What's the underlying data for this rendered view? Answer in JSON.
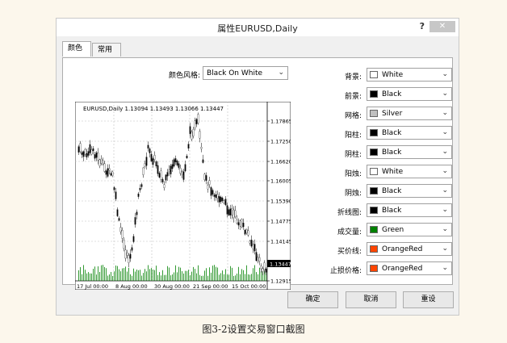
{
  "window": {
    "title": "属性EURUSD,Daily",
    "help": "?",
    "close": "✕"
  },
  "tabs": [
    {
      "label": "颜色"
    },
    {
      "label": "常用"
    }
  ],
  "color_style": {
    "label": "颜色风格:",
    "value": "Black On White"
  },
  "chart": {
    "info": "EURUSD,Daily  1.13094 1.13493 1.13066 1.13447",
    "price_ticks": [
      "1.17865",
      "1.17250",
      "1.16620",
      "1.16005",
      "1.15390",
      "1.14775",
      "1.14145",
      "1.13447",
      "1.12915"
    ],
    "current_price": "1.13447",
    "date_ticks": [
      "17 Jul 00:00",
      "8 Aug 00:00",
      "30 Aug 00:00",
      "21 Sep 00:00",
      "15 Oct 00:00"
    ]
  },
  "colors": [
    {
      "label": "背景:",
      "value": "White",
      "hex": "#ffffff"
    },
    {
      "label": "前景:",
      "value": "Black",
      "hex": "#000000"
    },
    {
      "label": "网格:",
      "value": "Silver",
      "hex": "#c0c0c0"
    },
    {
      "label": "阳柱:",
      "value": "Black",
      "hex": "#000000"
    },
    {
      "label": "阴柱:",
      "value": "Black",
      "hex": "#000000"
    },
    {
      "label": "阳烛:",
      "value": "White",
      "hex": "#ffffff"
    },
    {
      "label": "阴烛:",
      "value": "Black",
      "hex": "#000000"
    },
    {
      "label": "折线图:",
      "value": "Black",
      "hex": "#000000"
    },
    {
      "label": "成交量:",
      "value": "Green",
      "hex": "#008000"
    },
    {
      "label": "买价线:",
      "value": "OrangeRed",
      "hex": "#ff4500"
    },
    {
      "label": "止损价格:",
      "value": "OrangeRed",
      "hex": "#ff4500"
    }
  ],
  "buttons": {
    "ok": "确定",
    "cancel": "取消",
    "reset": "重设"
  },
  "caption": "图3-2设置交易窗口截图"
}
